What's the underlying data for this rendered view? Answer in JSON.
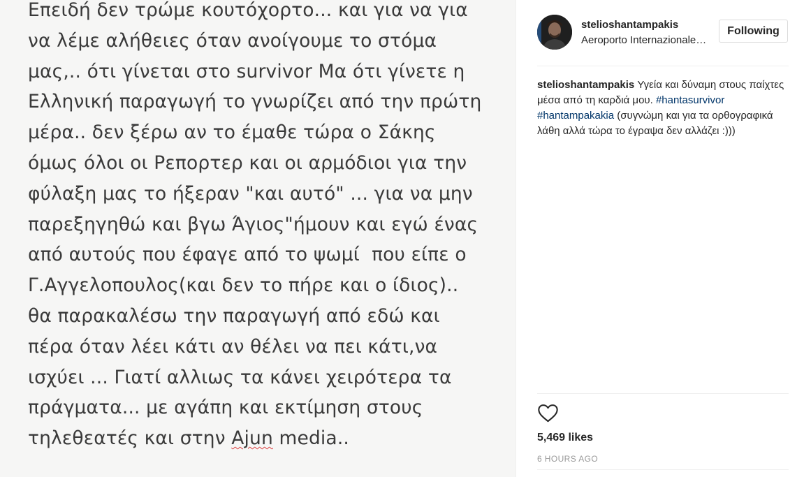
{
  "post": {
    "image_text_lines": [
      "Επειδή δεν τρώμε κουτόχορτο... και για να για",
      "να λέμε αλήθειες όταν ανοίγουμε το στόμα",
      "μας,.. ότι γίνεται στο survivor Μα ότι γίνετε η",
      "Ελληνική παραγωγή το γνωρίζει από την πρώτη",
      "μέρα.. δεν ξέρω αν το έμαθε τώρα ο Σάκης",
      "όμως όλοι οι Ρεπορτερ και οι αρμόδιοι για την",
      "φύλαξη μας το ήξεραν \"και αυτό\" ... για να μην",
      "παρεξηγηθώ και βγω Άγιος\"ήμουν και εγώ ένας",
      "από αυτούς που έφαγε από το ψωμί  που είπε ο",
      "Γ.Αγγελοπουλος(και δεν το πήρε και ο ίδιος)..",
      "θα παρακαλέσω την παραγωγή από εδώ και",
      "πέρα όταν λέει κάτι αν θέλει να πει κάτι,να",
      "ισχύει ... Γιατί αλλιως τα κάνει χειρότερα τα",
      "πράγματα... με αγάπη και εκτίμηση στους",
      "τηλεθεατές και στην "
    ],
    "last_line_misspelled_word": "Ajun",
    "last_line_end": " media.."
  },
  "header": {
    "username": "stelioshantampakis",
    "location": "Aeroporto Internazionale di Fiumicino",
    "follow_label": "Following"
  },
  "caption": {
    "username": "stelioshantampakis",
    "text_part1": "Υγεία και δύναμη στους παίχτες μέσα από τη καρδιά μου.",
    "hashtag1": "#hantasurvivor",
    "hashtag2": "#hantampakakia",
    "text_part2": "(συγνώμη και για τα ορθογραφικά λάθη αλλά τώρα το έγραψα δεν αλλάζει :)))"
  },
  "actions": {
    "like_icon": "heart-outline-icon"
  },
  "stats": {
    "likes": "5,469 likes",
    "time_ago": "6 HOURS AGO"
  },
  "colors": {
    "link": "#003569",
    "text": "#262626",
    "muted": "#999999",
    "image_bg": "#f6f6f5"
  }
}
